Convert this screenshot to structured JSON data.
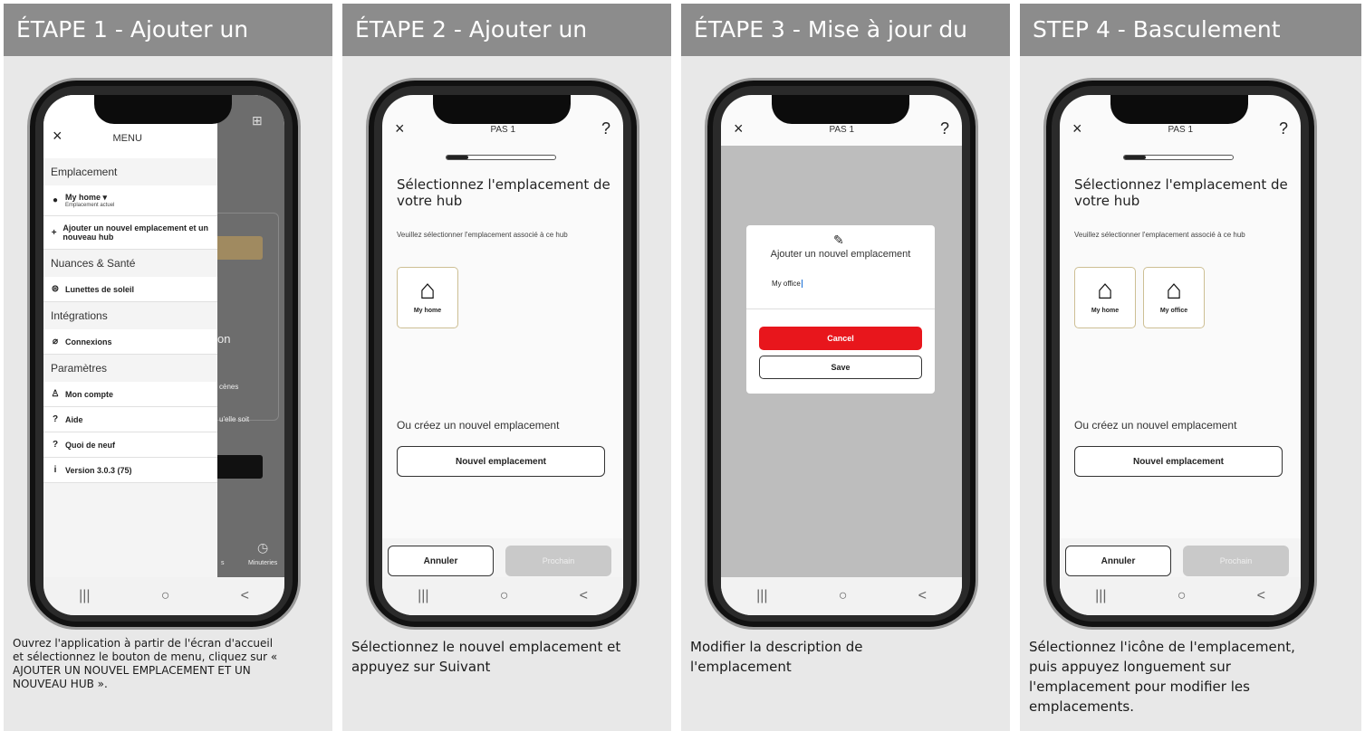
{
  "panels": [
    {
      "title": "ÉTAPE 1 - Ajouter un",
      "caption": "Ouvrez l'application à partir de l'écran d'accueil et sélectionnez le bouton de menu, cliquez sur « AJOUTER UN NOUVEL EMPLACEMENT ET UN NOUVEAU HUB ».",
      "menu": {
        "title": "MENU",
        "sections": {
          "location": "Emplacement",
          "shades": "Nuances & Santé",
          "integrations": "Intégrations",
          "settings": "Paramètres"
        },
        "current_location": "My home",
        "current_location_sub": "Emplacement actuel",
        "add_location": "Ajouter un nouvel emplacement et un nouveau hub",
        "sunglasses": "Lunettes de soleil",
        "connections": "Connexions",
        "account": "Mon compte",
        "help": "Aide",
        "whats_new": "Quoi de neuf",
        "version": "Version 3.0.3 (75)"
      },
      "background_fragments": {
        "n": "on",
        "scenes": "cènes",
        "whatever": "u'elle soit",
        "s": "s",
        "timers": "Minuteries"
      }
    },
    {
      "title": "ÉTAPE 2 - Ajouter un",
      "caption": "Sélectionnez le nouvel emplacement et appuyez sur Suivant",
      "screen_title": "PAS 1",
      "progress": 0.2,
      "heading": "Sélectionnez l'emplacement de votre hub",
      "subtext": "Veuillez sélectionner l'emplacement associé à ce hub",
      "locations": [
        "My home"
      ],
      "or_create": "Ou créez un nouvel emplacement",
      "new_location": "Nouvel emplacement",
      "cancel": "Annuler",
      "next": "Prochain"
    },
    {
      "title": "ÉTAPE 3 - Mise à jour du",
      "caption": "Modifier la description de l'emplacement",
      "screen_title": "PAS 1",
      "dialog_title": "Ajouter un nouvel emplacement",
      "input_value": "My office",
      "cancel": "Cancel",
      "save": "Save"
    },
    {
      "title": "STEP 4 - Basculement",
      "caption": "Sélectionnez l'icône de l'emplacement, puis appuyez longuement sur l'emplacement pour modifier les emplacements.",
      "screen_title": "PAS 1",
      "progress": 0.2,
      "heading": "Sélectionnez l'emplacement de votre hub",
      "subtext": "Veuillez sélectionner l'emplacement associé à ce hub",
      "locations": [
        "My home",
        "My office"
      ],
      "or_create": "Ou créez un nouvel emplacement",
      "new_location": "Nouvel emplacement",
      "cancel": "Annuler",
      "next": "Prochain"
    }
  ],
  "icons": {
    "close": "×",
    "help": "?",
    "home": "⌂",
    "nav_recent": "|||",
    "nav_home": "○",
    "nav_back": "<"
  },
  "colors": {
    "header_bg": "#8c8c8c",
    "panel_bg": "#e8e8e8",
    "accent_red": "#e8161c",
    "card_border": "#cdbf94"
  }
}
